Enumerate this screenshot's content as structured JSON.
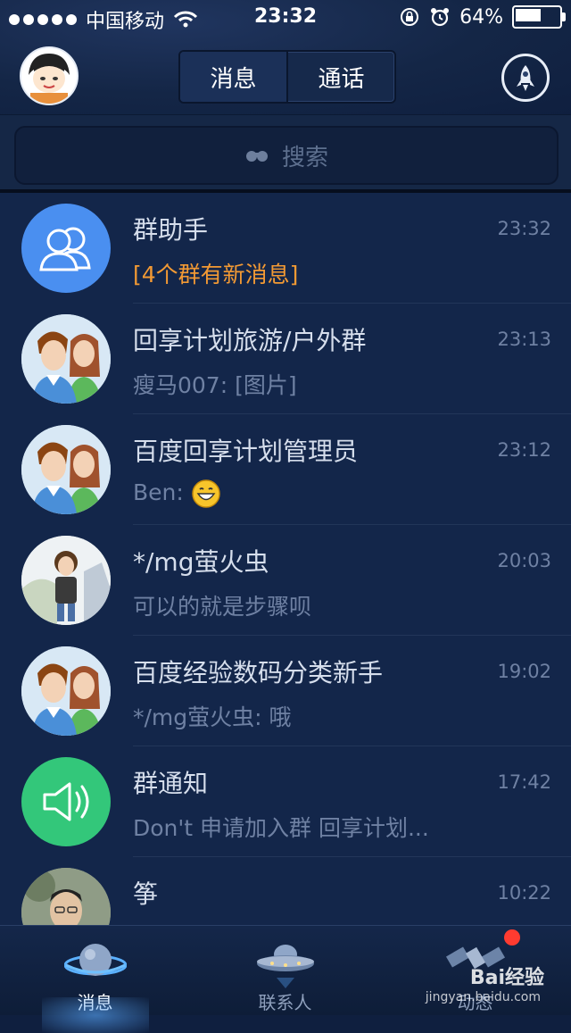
{
  "status_bar": {
    "carrier": "中国移动",
    "time": "23:32",
    "battery_percent": "64%",
    "battery_level": 0.64
  },
  "top_bar": {
    "tabs": [
      {
        "label": "消息",
        "active": true
      },
      {
        "label": "通话",
        "active": false
      }
    ],
    "icons": [
      "avatar",
      "rocket-icon"
    ]
  },
  "search": {
    "placeholder": "搜索",
    "icon": "binoculars-icon"
  },
  "conversations": [
    {
      "name": "群助手",
      "preview": "[4个群有新消息]",
      "time": "23:32",
      "avatar": "group-assistant-icon",
      "highlight": true
    },
    {
      "name": "回享计划旅游/户外群",
      "preview": "瘦马007: [图片]",
      "time": "23:13",
      "avatar": "couple-avatar"
    },
    {
      "name": "百度回享计划管理员",
      "preview": "Ben: ",
      "time": "23:12",
      "avatar": "couple-avatar",
      "emoji": "grin-emoji"
    },
    {
      "name": "*/mg萤火虫",
      "preview": "可以的就是步骤呗",
      "time": "20:03",
      "avatar": "person-photo"
    },
    {
      "name": "百度经验数码分类新手",
      "preview": "*/mg萤火虫: 哦",
      "time": "19:02",
      "avatar": "couple-avatar"
    },
    {
      "name": "群通知",
      "preview": "Don't 申请加入群 回享计划...",
      "time": "17:42",
      "avatar": "speaker-icon"
    },
    {
      "name": "筝",
      "preview": "",
      "time": "10:22",
      "avatar": "person-photo"
    }
  ],
  "tab_bar": {
    "tabs": [
      {
        "label": "消息",
        "icon": "planet-icon",
        "active": true
      },
      {
        "label": "联系人",
        "icon": "ufo-icon",
        "active": false
      },
      {
        "label": "动态",
        "icon": "satellite-icon",
        "active": false,
        "badge": true
      }
    ]
  },
  "watermark": {
    "text": "Bai经验",
    "sub": "jingyan.baidu.com"
  },
  "colors": {
    "background": "#13264a",
    "highlight": "#f39a34",
    "group_assistant": "#4a8ff0",
    "group_notice": "#33c77a",
    "badge": "#ff3b30"
  }
}
